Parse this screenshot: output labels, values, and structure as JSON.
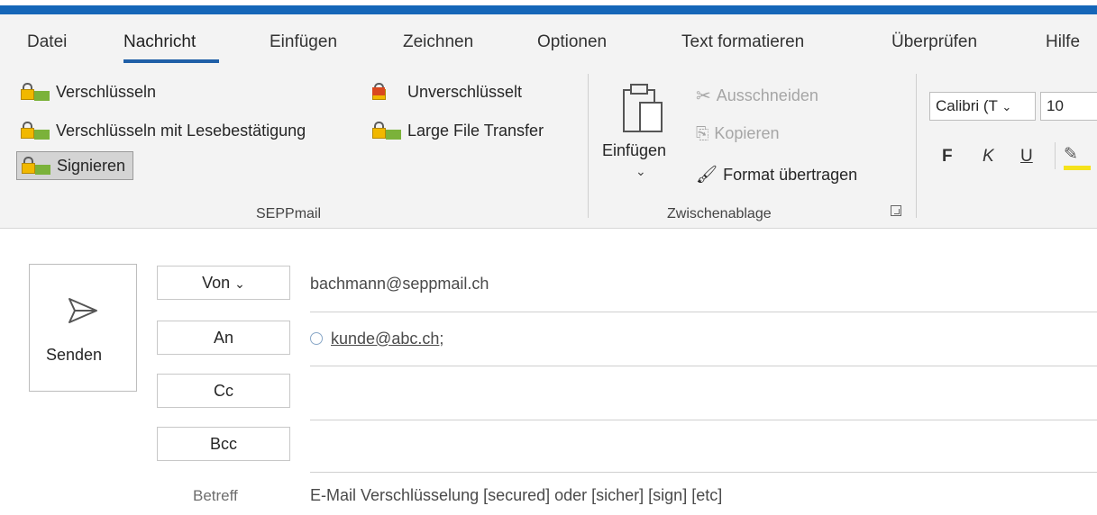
{
  "colors": {
    "title_bar": "#1566b8",
    "tab_underline": "#1f5fa7",
    "ribbon_bg": "#f3f3f3"
  },
  "tabs": [
    {
      "label": "Datei",
      "active": false
    },
    {
      "label": "Nachricht",
      "active": true
    },
    {
      "label": "Einfügen",
      "active": false
    },
    {
      "label": "Zeichnen",
      "active": false
    },
    {
      "label": "Optionen",
      "active": false
    },
    {
      "label": "Text formatieren",
      "active": false
    },
    {
      "label": "Überprüfen",
      "active": false
    },
    {
      "label": "Hilfe",
      "active": false
    }
  ],
  "seppmail": {
    "group_label": "SEPPmail",
    "encrypt_label": "Verschlüsseln",
    "encrypt_receipt_label": "Verschlüsseln mit Lesebestätigung",
    "sign_label": "Signieren",
    "sign_pressed": true,
    "unencrypted_label": "Unverschlüsselt",
    "large_file_label": "Large File Transfer"
  },
  "clipboard": {
    "group_label": "Zwischenablage",
    "paste_label": "Einfügen",
    "cut_label": "Ausschneiden",
    "copy_label": "Kopieren",
    "format_painter_label": "Format übertragen"
  },
  "font": {
    "family": "Calibri (T",
    "size": "10",
    "bold": "F",
    "italic": "K",
    "underline": "U"
  },
  "compose": {
    "send_label": "Senden",
    "from_button": "Von",
    "from_value": "bachmann@seppmail.ch",
    "to_button": "An",
    "to_value": "kunde@abc.ch",
    "to_separator": ";",
    "cc_button": "Cc",
    "bcc_button": "Bcc",
    "subject_label": "Betreff",
    "subject_value": "E-Mail Verschlüsselung  [secured] oder [sicher] [sign] [etc]"
  }
}
